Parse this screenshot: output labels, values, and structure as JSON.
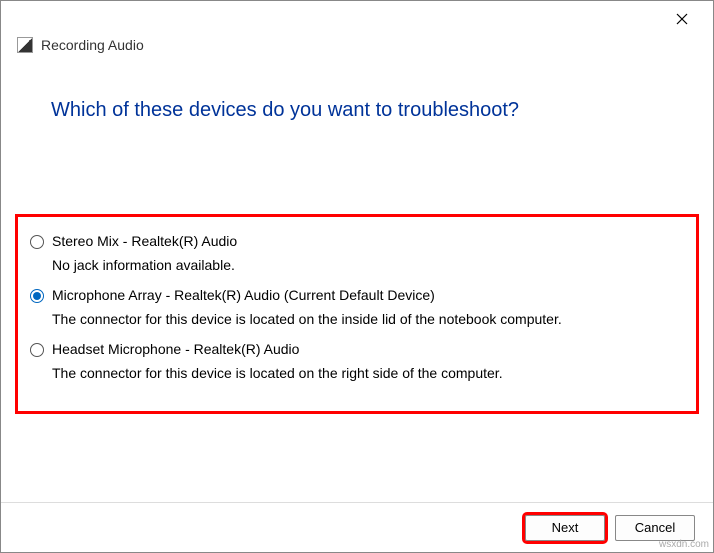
{
  "window": {
    "title": "Recording Audio"
  },
  "heading": "Which of these devices do you want to troubleshoot?",
  "options": [
    {
      "label": "Stereo Mix - Realtek(R) Audio",
      "description": "No jack information available.",
      "selected": false
    },
    {
      "label": "Microphone Array - Realtek(R) Audio (Current Default Device)",
      "description": "The connector for this device is located on the inside lid of the notebook computer.",
      "selected": true
    },
    {
      "label": "Headset Microphone - Realtek(R) Audio",
      "description": "The connector for this device is located on the right side of the computer.",
      "selected": false
    }
  ],
  "buttons": {
    "next": "Next",
    "cancel": "Cancel"
  },
  "watermark": "wsxdn.com"
}
